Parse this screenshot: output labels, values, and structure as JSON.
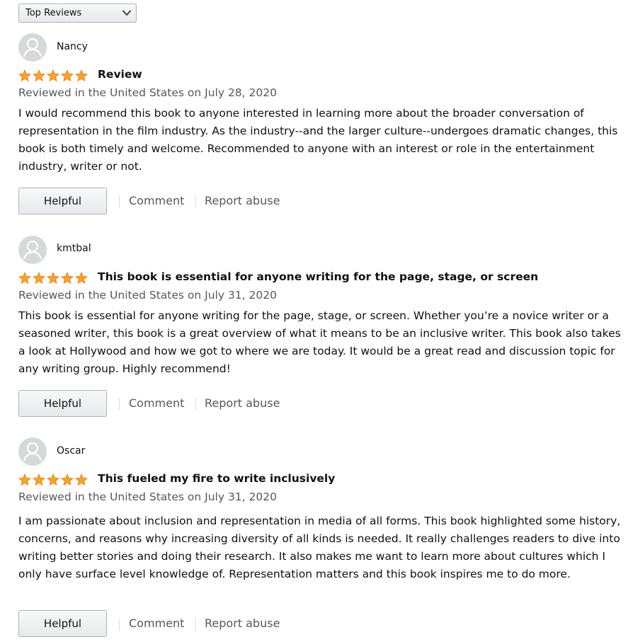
{
  "sort": {
    "selected": "Top Reviews",
    "icon": "chevron-down-icon"
  },
  "colors": {
    "star": "#ffa41c",
    "star_outline": "#de7921",
    "avatar_bg": "#d5d9d9",
    "avatar_fg": "#ffffff",
    "meta_text": "#565959"
  },
  "reviews": [
    {
      "author": "Nancy",
      "rating": 5,
      "rating_max": 5,
      "title": "Review",
      "meta": "Reviewed in the United States on July 28, 2020",
      "body": "I would recommend this book to anyone interested in learning more about the broader conversation of representation in the film industry. As the industry--and the larger culture--undergoes dramatic changes, this book is both timely and welcome. Recommended to anyone with an interest or role in the entertainment industry, writer or not.",
      "helpful_label": "Helpful",
      "comment_label": "Comment",
      "report_label": "Report abuse"
    },
    {
      "author": "kmtbal",
      "rating": 5,
      "rating_max": 5,
      "title": "This book is essential for anyone writing for the page, stage, or screen",
      "meta": "Reviewed in the United States on July 31, 2020",
      "body": "This book is essential for anyone writing for the page, stage, or screen. Whether you’re a novice writer or a seasoned writer, this book is a great overview of what it means to be an inclusive writer. This book also takes a look at Hollywood and how we got to where we are today. It would be a great read and discussion topic for any writing group. Highly recommend!",
      "helpful_label": "Helpful",
      "comment_label": "Comment",
      "report_label": "Report abuse"
    },
    {
      "author": "Oscar",
      "rating": 5,
      "rating_max": 5,
      "title": "This fueled my fire to write inclusively",
      "meta": "Reviewed in the United States on July 31, 2020",
      "body": "I am passionate about inclusion and representation in media of all forms. This book highlighted some history, concerns, and reasons why increasing diversity of all kinds is needed. It really challenges readers to dive into writing better stories and doing their research. It also makes me want to learn more about cultures which I only have surface level knowledge of. Representation matters and this book inspires me to do more.",
      "helpful_label": "Helpful",
      "comment_label": "Comment",
      "report_label": "Report abuse"
    }
  ]
}
